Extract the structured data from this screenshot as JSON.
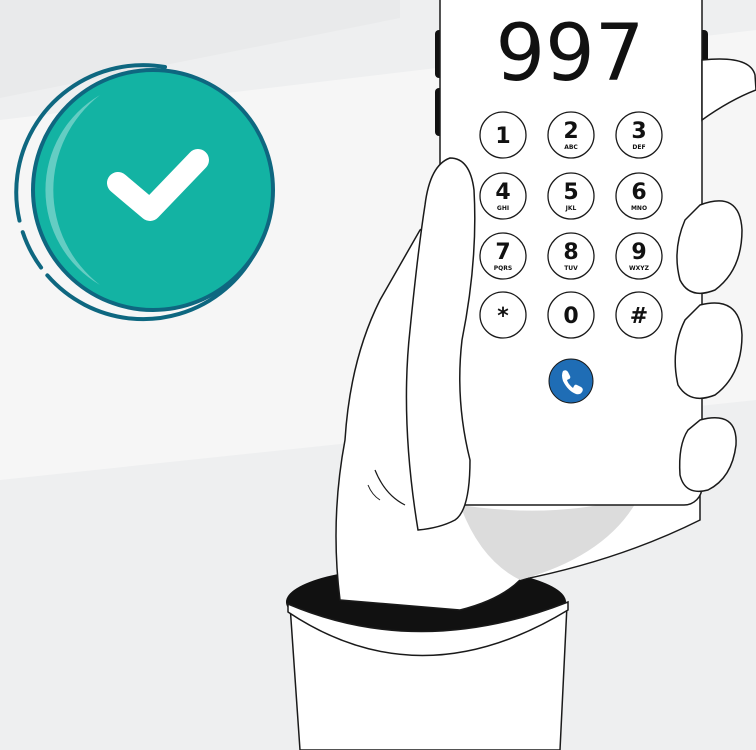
{
  "dialer": {
    "number": "997",
    "keys": [
      {
        "digit": "1",
        "letters": ""
      },
      {
        "digit": "2",
        "letters": "ABC"
      },
      {
        "digit": "3",
        "letters": "DEF"
      },
      {
        "digit": "4",
        "letters": "GHI"
      },
      {
        "digit": "5",
        "letters": "JKL"
      },
      {
        "digit": "6",
        "letters": "MNO"
      },
      {
        "digit": "7",
        "letters": "PQRS"
      },
      {
        "digit": "8",
        "letters": "TUV"
      },
      {
        "digit": "9",
        "letters": "WXYZ"
      },
      {
        "digit": "*",
        "letters": ""
      },
      {
        "digit": "0",
        "letters": ""
      },
      {
        "digit": "#",
        "letters": ""
      }
    ],
    "call_icon": "phone-handset-icon"
  },
  "badge": {
    "icon": "checkmark-icon"
  },
  "colors": {
    "check_fill": "#13b3a3",
    "check_ring": "#0e6780",
    "check_highlight": "#6ecfc6",
    "call_button": "#1f6db5",
    "background": "#eeeff0",
    "outline": "#1a1a1a"
  }
}
